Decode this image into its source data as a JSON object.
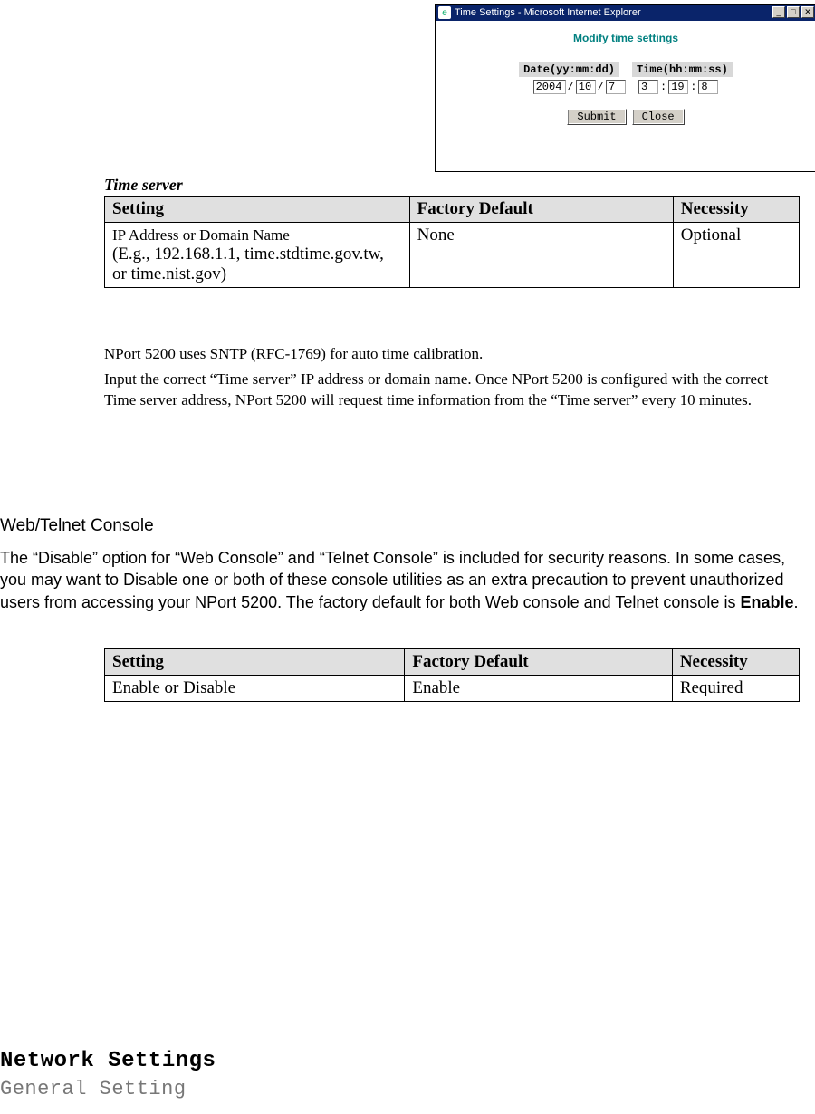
{
  "browser": {
    "title": "Time Settings - Microsoft Internet Explorer",
    "modifyTitle": "Modify time settings",
    "dateLabel": "Date(yy:mm:dd)",
    "timeLabel": "Time(hh:mm:ss)",
    "year": "2004",
    "month": "10",
    "day": "7",
    "hour": "3",
    "minute": "19",
    "second": "8",
    "submit": "Submit",
    "close": "Close",
    "minimize": "_",
    "maximize": "□",
    "closeX": "✕"
  },
  "timeServerHeading": "Time server",
  "tableHeaders": {
    "setting": "Setting",
    "factoryDefault": "Factory Default",
    "necessity": "Necessity"
  },
  "table1": {
    "settingLine1": "IP Address or Domain Name",
    "settingLine2": "(E.g., 192.168.1.1, time.stdtime.gov.tw, or time.nist.gov)",
    "default": "None",
    "necessity": "Optional"
  },
  "paraSntp": "NPort 5200 uses SNTP (RFC-1769) for auto time calibration.",
  "paraInput": "Input the correct “Time server” IP address or domain name. Once NPort 5200 is configured with the correct Time server address, NPort 5200 will request time information from the “Time server” every 10 minutes.",
  "wtHeading": "Web/Telnet Console",
  "wtParaPrefix": "The “Disable” option for “Web Console” and “Telnet Console” is included for security reasons. In some cases, you may want to Disable one or both of these console utilities as an extra precaution to prevent unauthorized users from accessing your NPort 5200. The factory default for both Web console and Telnet console is ",
  "wtParaBold": "Enable",
  "wtParaSuffix": ".",
  "table2": {
    "setting": "Enable or Disable",
    "default": "Enable",
    "necessity": "Required"
  },
  "footerBig": "Network Settings",
  "footerSmall": "General Setting"
}
